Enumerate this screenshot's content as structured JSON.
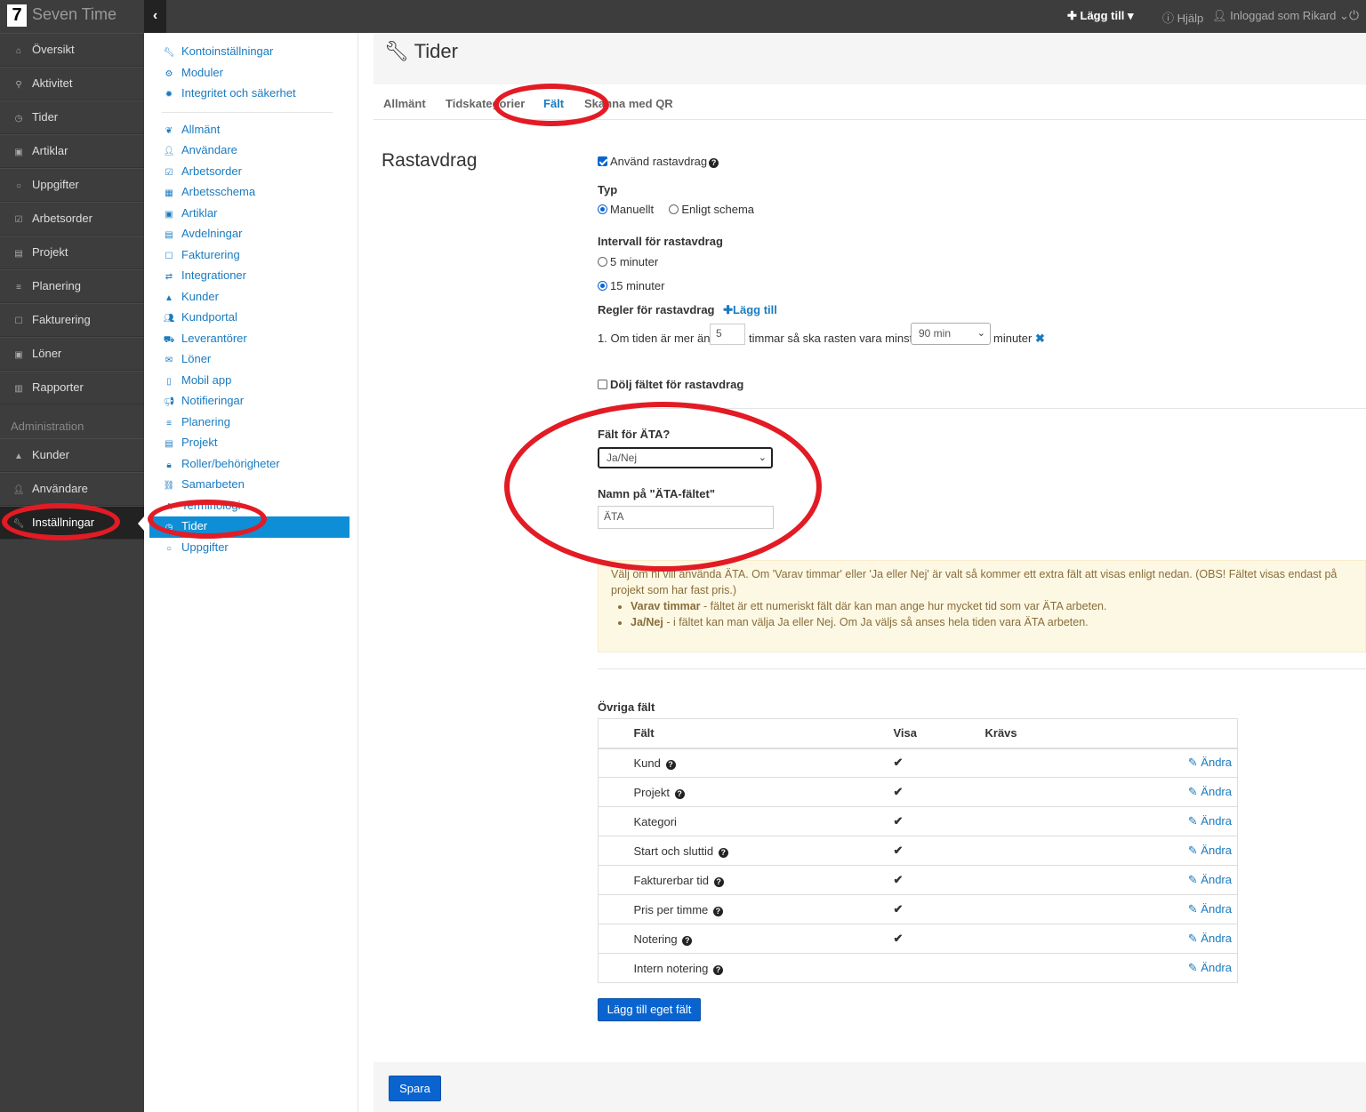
{
  "app": {
    "logo": "7",
    "name": "Seven Time"
  },
  "topbar": {
    "add": "✚ Lägg till ▾",
    "help": "Hjälp",
    "user": "Inloggad som Rikard"
  },
  "leftnav": {
    "items": [
      "Översikt",
      "Aktivitet",
      "Tider",
      "Artiklar",
      "Uppgifter",
      "Arbetsorder",
      "Projekt",
      "Planering",
      "Fakturering",
      "Löner",
      "Rapporter"
    ],
    "section": "Administration",
    "admin_items": [
      "Kunder",
      "Användare",
      "Inställningar"
    ]
  },
  "subnav": {
    "group1": [
      "Kontoinställningar",
      "Moduler",
      "Integritet och säkerhet"
    ],
    "group2": [
      "Allmänt",
      "Användare",
      "Arbetsorder",
      "Arbetsschema",
      "Artiklar",
      "Avdelningar",
      "Fakturering",
      "Integrationer",
      "Kunder",
      "Kundportal",
      "Leverantörer",
      "Löner",
      "Mobil app",
      "Notifieringar",
      "Planering",
      "Projekt",
      "Roller/behörigheter",
      "Samarbeten",
      "Terminologi",
      "Tider",
      "Uppgifter"
    ]
  },
  "page": {
    "title": "Tider"
  },
  "tabs": [
    "Allmänt",
    "Tidskategorier",
    "Fält",
    "Skanna med QR"
  ],
  "rast": {
    "section_title": "Rastavdrag",
    "use_label": "Använd rastavdrag",
    "type_label": "Typ",
    "type_opt1": "Manuellt",
    "type_opt2": "Enligt schema",
    "interval_label": "Intervall för rastavdrag",
    "int_opt1": "5 minuter",
    "int_opt2": "15 minuter",
    "rules_label": "Regler för rastavdrag",
    "rules_add": "Lägg till",
    "rule_prefix": "1. Om tiden är mer än",
    "rule_hours": "5",
    "rule_mid": "timmar så ska rasten vara minst",
    "rule_select": "90 min",
    "rule_suffix": "minuter",
    "hide_label": "Dölj fältet för rastavdrag"
  },
  "ata": {
    "field_label": "Fält för ÄTA?",
    "field_value": "Ja/Nej",
    "name_label": "Namn på \"ÄTA-fältet\"",
    "name_value": "ÄTA",
    "info": "Välj om ni vill använda ÄTA. Om 'Varav timmar' eller 'Ja eller Nej' är valt så kommer ett extra fält att visas enligt nedan. (OBS! Fältet visas endast på projekt som har fast pris.)",
    "b1_title": "Varav timmar",
    "b1_text": " - fältet är ett numeriskt fält där kan man ange hur mycket tid som var ÄTA arbeten.",
    "b2_title": "Ja/Nej",
    "b2_text": " - i fältet kan man välja Ja eller Nej. Om Ja väljs så anses hela tiden vara ÄTA arbeten."
  },
  "other": {
    "title": "Övriga fält",
    "headers": [
      "Fält",
      "Visa",
      "Krävs"
    ],
    "edit_label": "Ändra",
    "rows": [
      {
        "name": "Kund",
        "help": true,
        "visa": "✔"
      },
      {
        "name": "Projekt",
        "help": true,
        "visa": "✔"
      },
      {
        "name": "Kategori",
        "help": false,
        "visa": "✔"
      },
      {
        "name": "Start och sluttid",
        "help": true,
        "visa": "✔"
      },
      {
        "name": "Fakturerbar tid",
        "help": true,
        "visa": "✔"
      },
      {
        "name": "Pris per timme",
        "help": true,
        "visa": "✔"
      },
      {
        "name": "Notering",
        "help": true,
        "visa": "✔"
      },
      {
        "name": "Intern notering",
        "help": true,
        "visa": ""
      }
    ],
    "add_button": "Lägg till eget fält"
  },
  "save_button": "Spara"
}
